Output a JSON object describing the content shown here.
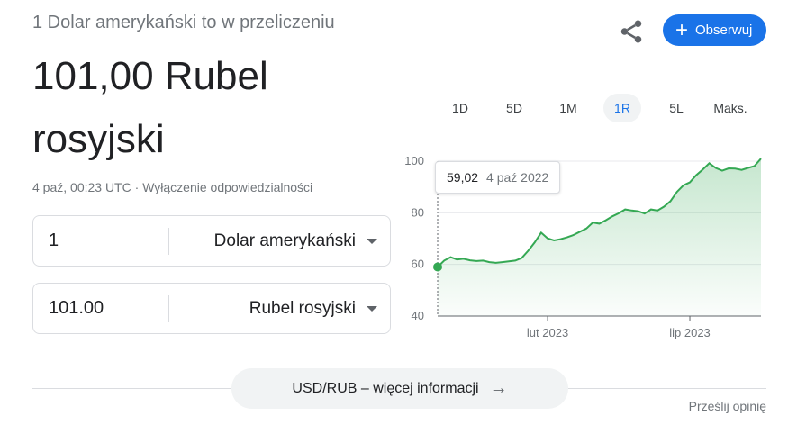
{
  "header": {
    "subtitle": "1 Dolar amerykański to w przeliczeniu",
    "result_line1": "101,00 Rubel",
    "result_line2": "rosyjski",
    "follow_label": "Obserwuj",
    "share_icon": "share-icon"
  },
  "meta": {
    "timestamp": "4 paź, 00:23 UTC",
    "separator": " · ",
    "disclaimer": "Wyłączenie odpowiedzialności"
  },
  "converter": {
    "from": {
      "amount": "1",
      "currency": "Dolar amerykański"
    },
    "to": {
      "amount": "101.00",
      "currency": "Rubel rosyjski"
    }
  },
  "ranges": {
    "items": [
      "1D",
      "5D",
      "1M",
      "1R",
      "5L",
      "Maks."
    ],
    "active": "1R"
  },
  "tooltip": {
    "value": "59,02",
    "date": "4 paź 2022"
  },
  "chart_data": {
    "type": "area",
    "color": "#34a853",
    "ylim": [
      40,
      100
    ],
    "yticks": [
      "100",
      "80",
      "60",
      "40"
    ],
    "xticks": [
      {
        "label": "lut 2023",
        "pos": 0.34
      },
      {
        "label": "lip 2023",
        "pos": 0.78
      }
    ],
    "x_start": "2022-10-04",
    "x_end": "2023-10-04",
    "values": [
      59.02,
      61.5,
      62.8,
      61.9,
      62.2,
      61.6,
      61.3,
      61.5,
      60.9,
      60.6,
      60.9,
      61.2,
      61.5,
      62.5,
      65.3,
      68.5,
      72.3,
      70.1,
      69.3,
      69.8,
      70.5,
      71.4,
      72.7,
      73.9,
      76.2,
      75.8,
      77.1,
      78.6,
      79.8,
      81.3,
      80.9,
      80.6,
      79.7,
      81.3,
      80.9,
      82.4,
      84.5,
      88.1,
      90.6,
      91.8,
      94.6,
      96.8,
      99.2,
      97.4,
      96.3,
      97.2,
      97.1,
      96.6,
      97.4,
      98.1,
      101.0
    ],
    "x": [
      0,
      0.02,
      0.04,
      0.06,
      0.08,
      0.1,
      0.12,
      0.14,
      0.16,
      0.18,
      0.2,
      0.22,
      0.24,
      0.26,
      0.28,
      0.3,
      0.32,
      0.34,
      0.36,
      0.38,
      0.4,
      0.42,
      0.44,
      0.46,
      0.48,
      0.5,
      0.52,
      0.54,
      0.56,
      0.58,
      0.6,
      0.62,
      0.64,
      0.66,
      0.68,
      0.7,
      0.72,
      0.74,
      0.76,
      0.78,
      0.8,
      0.82,
      0.84,
      0.86,
      0.88,
      0.9,
      0.92,
      0.94,
      0.96,
      0.98,
      1.0
    ]
  },
  "footer": {
    "more_label": "USD/RUB – więcej informacji",
    "feedback_label": "Prześlij opinię"
  }
}
